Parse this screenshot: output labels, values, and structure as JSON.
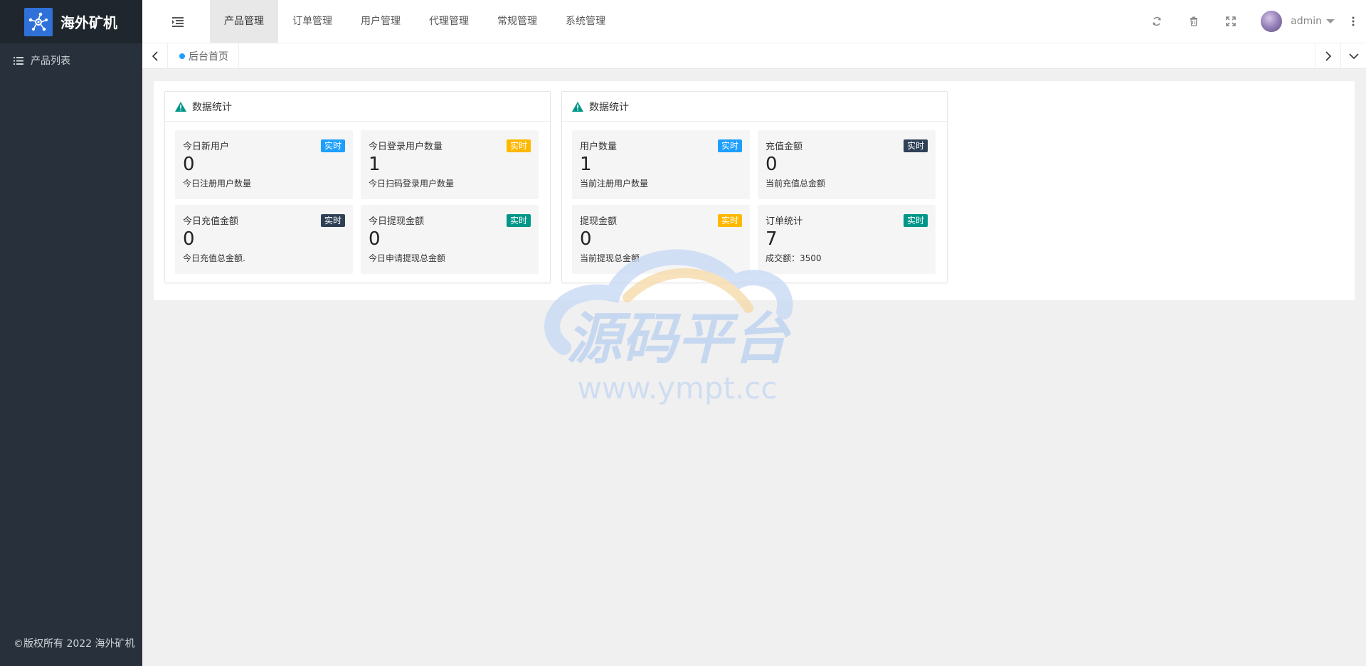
{
  "sidebar": {
    "logo_text": "海外矿机",
    "items": [
      {
        "label": "产品列表",
        "icon": "list-icon"
      }
    ],
    "footer": "©版权所有 2022 海外矿机"
  },
  "header": {
    "nav": [
      "产品管理",
      "订单管理",
      "用户管理",
      "代理管理",
      "常规管理",
      "系统管理"
    ],
    "active_nav": "产品管理",
    "icons": [
      "refresh-icon",
      "trash-icon",
      "fullscreen-icon",
      "more-vertical-icon"
    ],
    "username": "admin"
  },
  "tabbar": {
    "tabs": [
      "后台首页"
    ]
  },
  "panels": [
    {
      "title": "数据统计",
      "boxes": [
        {
          "label": "今日新用户",
          "badge": "实时",
          "badge_color": "#1e9fff",
          "value": "0",
          "desc": "今日注册用户数量"
        },
        {
          "label": "今日登录用户数量",
          "badge": "实时",
          "badge_color": "#ffb800",
          "value": "1",
          "desc": "今日扫码登录用户数量"
        },
        {
          "label": "今日充值金额",
          "badge": "实时",
          "badge_color": "#2f4056",
          "value": "0",
          "desc": "今日充值总金额."
        },
        {
          "label": "今日提现金额",
          "badge": "实时",
          "badge_color": "#009688",
          "value": "0",
          "desc": "今日申请提现总金额"
        }
      ]
    },
    {
      "title": "数据统计",
      "boxes": [
        {
          "label": "用户数量",
          "badge": "实时",
          "badge_color": "#1e9fff",
          "value": "1",
          "desc": "当前注册用户数量"
        },
        {
          "label": "充值金额",
          "badge": "实时",
          "badge_color": "#2f4056",
          "value": "0",
          "desc": "当前充值总金额"
        },
        {
          "label": "提现金额",
          "badge": "实时",
          "badge_color": "#ffb800",
          "value": "0",
          "desc": "当前提现总金额"
        },
        {
          "label": "订单统计",
          "badge": "实时",
          "badge_color": "#009688",
          "value": "7",
          "desc": "成交额：3500"
        }
      ]
    }
  ],
  "watermark": {
    "title": "源码平台",
    "url": "www.ympt.cc"
  }
}
